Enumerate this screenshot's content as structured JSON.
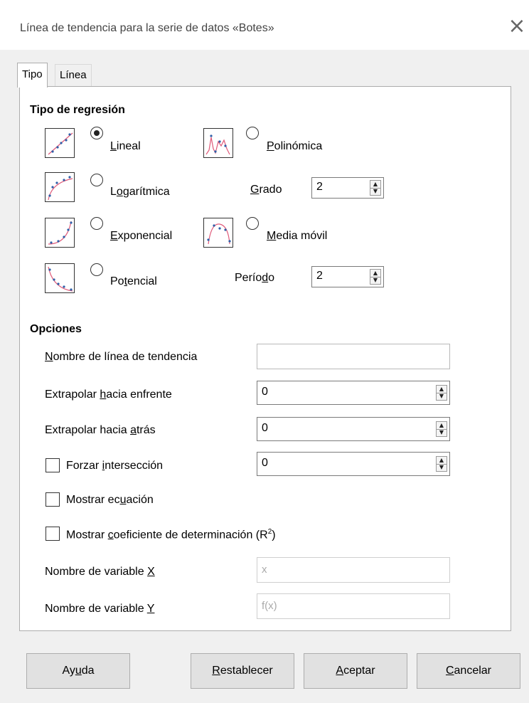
{
  "window": {
    "title": "Línea de tendencia para la serie de datos «Botes»"
  },
  "tabs": [
    {
      "label": "Tipo",
      "active": true
    },
    {
      "label": "Línea",
      "active": false
    }
  ],
  "regression": {
    "heading": "Tipo de regresión",
    "options": [
      {
        "label_pre": "",
        "label_u": "L",
        "label_post": "ineal",
        "checked": true
      },
      {
        "label_pre": "",
        "label_u": "P",
        "label_post": "olinómica",
        "checked": false
      },
      {
        "label_pre": "L",
        "label_u": "o",
        "label_post": "garítmica",
        "checked": false
      },
      {
        "label_pre": "",
        "label_u": "E",
        "label_post": "xponencial",
        "checked": false
      },
      {
        "label_pre": "",
        "label_u": "M",
        "label_post": "edia móvil",
        "checked": false
      },
      {
        "label_pre": "Po",
        "label_u": "t",
        "label_post": "encial",
        "checked": false
      }
    ],
    "degree": {
      "label_u": "G",
      "label_post": "rado",
      "value": "2"
    },
    "period": {
      "label_pre": "Perío",
      "label_u": "d",
      "label_post": "o",
      "value": "2"
    }
  },
  "options": {
    "heading": "Opciones",
    "trendline_name": {
      "label_u": "N",
      "label_post": "ombre de línea de tendencia",
      "value": ""
    },
    "extrapolate_forward": {
      "label_pre": "Extrapolar ",
      "label_u": "h",
      "label_post": "acia enfrente",
      "value": "0"
    },
    "extrapolate_backward": {
      "label_pre": "Extrapolar hacia ",
      "label_u": "a",
      "label_post": "trás",
      "value": "0"
    },
    "force_intercept": {
      "label_pre": "Forzar ",
      "label_u": "i",
      "label_post": "ntersección",
      "value": "0",
      "checked": false
    },
    "show_equation": {
      "label_pre": "Mostrar ec",
      "label_u": "u",
      "label_post": "ación",
      "checked": false
    },
    "show_r2": {
      "label_pre": "Mostrar ",
      "label_u": "c",
      "label_post": "oeficiente de determinación (R",
      "sup": "2",
      "close": ")",
      "checked": false
    },
    "x_name": {
      "label_pre": "Nombre de variable ",
      "label_u": "X",
      "placeholder": "x"
    },
    "y_name": {
      "label_pre": "Nombre de variable ",
      "label_u": "Y",
      "placeholder": "f(x)"
    }
  },
  "buttons": {
    "help": {
      "pre": "Ay",
      "u": "u",
      "post": "da"
    },
    "reset": {
      "pre": "",
      "u": "R",
      "post": "establecer"
    },
    "ok": {
      "pre": "",
      "u": "A",
      "post": "ceptar"
    },
    "cancel": {
      "pre": "",
      "u": "C",
      "post": "ancelar"
    }
  },
  "icons": {
    "close": "close-icon",
    "spin_up": "▲",
    "spin_down": "▼"
  }
}
